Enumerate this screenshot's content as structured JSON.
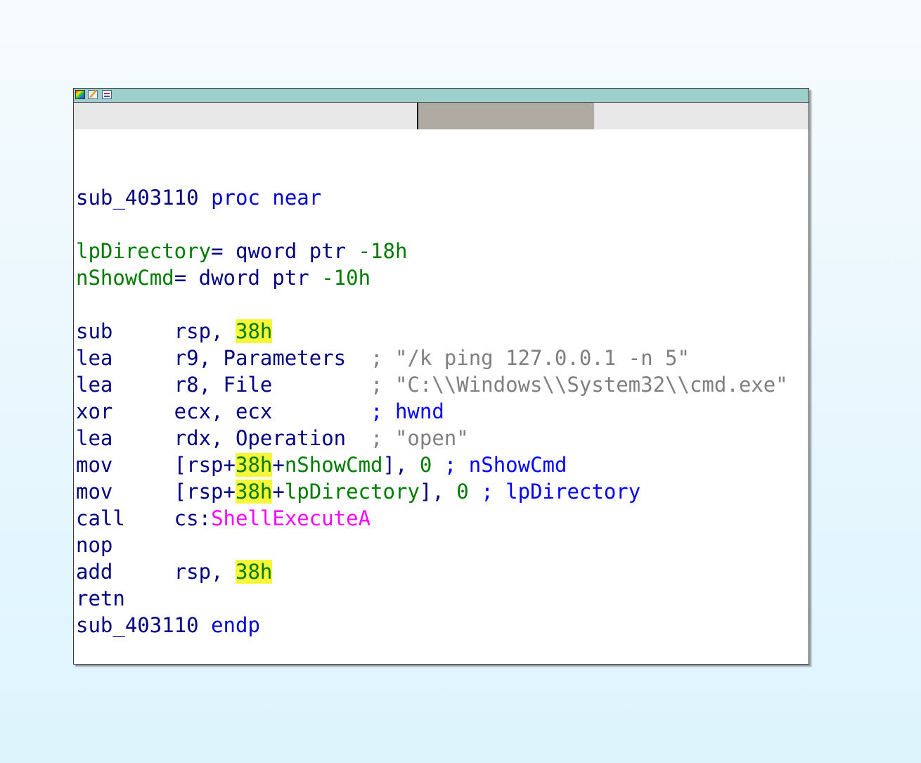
{
  "node": {
    "lines": [
      {
        "tokens": [
          {
            "t": "sub_403110",
            "c": "name"
          },
          {
            "t": " proc near",
            "c": "kw"
          }
        ]
      },
      {
        "tokens": []
      },
      {
        "tokens": [
          {
            "t": "lpDirectory",
            "c": "var"
          },
          {
            "t": "= qword ptr ",
            "c": "name"
          },
          {
            "t": "-18h",
            "c": "num"
          }
        ]
      },
      {
        "tokens": [
          {
            "t": "nShowCmd",
            "c": "var"
          },
          {
            "t": "= dword ptr ",
            "c": "name"
          },
          {
            "t": "-10h",
            "c": "num"
          }
        ]
      },
      {
        "tokens": []
      },
      {
        "tokens": [
          {
            "t": "sub     rsp, ",
            "c": "name"
          },
          {
            "t": "38h",
            "c": "hl"
          }
        ]
      },
      {
        "tokens": [
          {
            "t": "lea     r9, Parameters  ",
            "c": "name"
          },
          {
            "t": "; \"/k ping 127.0.0.1 -n 5\"",
            "c": "cmt"
          }
        ]
      },
      {
        "tokens": [
          {
            "t": "lea     r8, File        ",
            "c": "name"
          },
          {
            "t": "; \"C:\\\\Windows\\\\System32\\\\cmd.exe\"",
            "c": "cmt"
          }
        ]
      },
      {
        "tokens": [
          {
            "t": "xor     ecx, ecx        ",
            "c": "name"
          },
          {
            "t": "; hwnd",
            "c": "ref"
          }
        ]
      },
      {
        "tokens": [
          {
            "t": "lea     rdx, Operation  ",
            "c": "name"
          },
          {
            "t": "; \"open\"",
            "c": "cmt"
          }
        ]
      },
      {
        "tokens": [
          {
            "t": "mov     [rsp+",
            "c": "name"
          },
          {
            "t": "38h",
            "c": "hl"
          },
          {
            "t": "+",
            "c": "name"
          },
          {
            "t": "nShowCmd",
            "c": "var"
          },
          {
            "t": "], ",
            "c": "name"
          },
          {
            "t": "0",
            "c": "num"
          },
          {
            "t": " ; nShowCmd",
            "c": "ref"
          }
        ]
      },
      {
        "tokens": [
          {
            "t": "mov     [rsp+",
            "c": "name"
          },
          {
            "t": "38h",
            "c": "hl"
          },
          {
            "t": "+",
            "c": "name"
          },
          {
            "t": "lpDirectory",
            "c": "var"
          },
          {
            "t": "], ",
            "c": "name"
          },
          {
            "t": "0",
            "c": "num"
          },
          {
            "t": " ; lpDirectory",
            "c": "ref"
          }
        ]
      },
      {
        "tokens": [
          {
            "t": "call    cs:",
            "c": "name"
          },
          {
            "t": "ShellExecuteA",
            "c": "imp"
          }
        ]
      },
      {
        "tokens": [
          {
            "t": "nop",
            "c": "name"
          }
        ]
      },
      {
        "tokens": [
          {
            "t": "add     rsp, ",
            "c": "name"
          },
          {
            "t": "38h",
            "c": "hl"
          }
        ]
      },
      {
        "tokens": [
          {
            "t": "retn",
            "c": "name"
          }
        ]
      },
      {
        "tokens": [
          {
            "t": "sub_403110",
            "c": "name"
          },
          {
            "t": " endp",
            "c": "kw"
          }
        ]
      }
    ]
  },
  "colors": {
    "titlebar": "#9dd0cc",
    "highlight": "#f7f73a",
    "import": "#ff00ff",
    "comment": "#7f7f7f",
    "variable": "#007a00"
  },
  "icons": [
    "color-palette-icon",
    "rename-icon",
    "graph-view-icon"
  ]
}
